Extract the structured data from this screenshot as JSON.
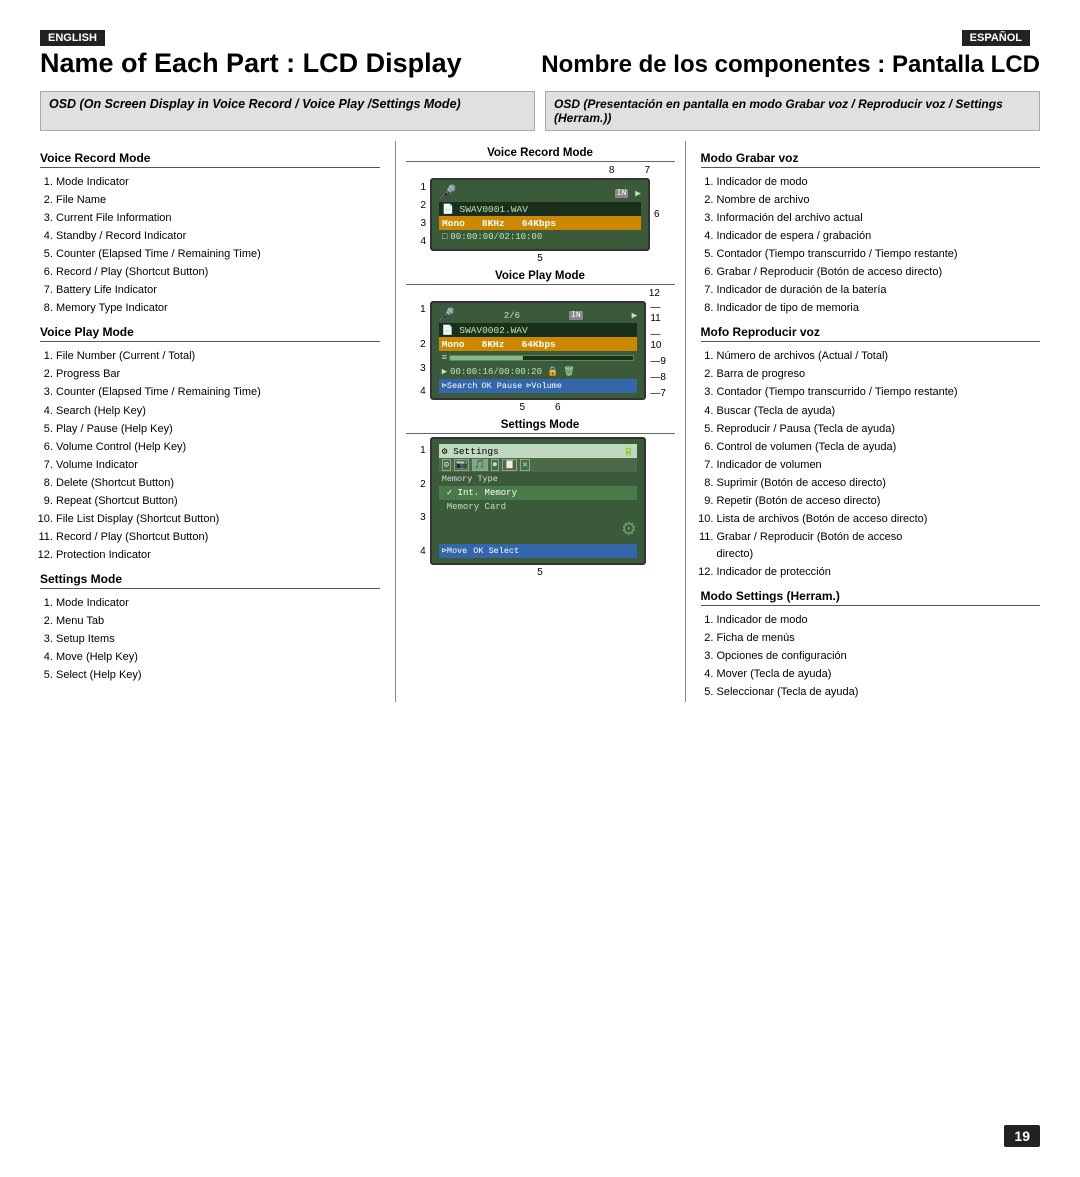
{
  "page": {
    "number": "19",
    "lang_left": "ENGLISH",
    "lang_right": "ESPAÑOL",
    "title_left": "Name of Each Part : LCD Display",
    "title_right": "Nombre de los componentes : Pantalla LCD",
    "subtitle_left": "OSD (On Screen Display in Voice Record / Voice Play /Settings Mode)",
    "subtitle_right": "OSD (Presentación en pantalla en modo Grabar voz / Reproducir voz / Settings (Herram.))"
  },
  "sections": {
    "voice_record_mode": {
      "heading": "Voice Record Mode",
      "items": [
        "Mode Indicator",
        "File Name",
        "Current File Information",
        "Standby / Record Indicator",
        "Counter (Elapsed Time / Remaining Time)",
        "Record / Play (Shortcut Button)",
        "Battery Life Indicator",
        "Memory Type Indicator"
      ]
    },
    "voice_play_mode": {
      "heading": "Voice Play Mode",
      "items": [
        "File Number (Current / Total)",
        "Progress Bar",
        "Counter (Elapsed Time / Remaining Time)",
        "Search (Help Key)",
        "Play / Pause (Help Key)",
        "Volume Control (Help Key)",
        "Volume Indicator",
        "Delete (Shortcut Button)",
        "Repeat (Shortcut Button)",
        "File List Display (Shortcut Button)",
        "Record / Play (Shortcut Button)",
        "Protection Indicator"
      ]
    },
    "settings_mode": {
      "heading": "Settings Mode",
      "items": [
        "Mode Indicator",
        "Menu Tab",
        "Setup Items",
        "Move (Help Key)",
        "Select (Help Key)"
      ]
    },
    "modo_grabar": {
      "heading": "Modo Grabar voz",
      "items": [
        "Indicador de modo",
        "Nombre de archivo",
        "Información del archivo actual",
        "Indicador de espera / grabación",
        "Contador (Tiempo transcurrido / Tiempo restante)",
        "Grabar / Reproducir (Botón de acceso directo)",
        "Indicador de duración de la batería",
        "Indicador de tipo de memoria"
      ]
    },
    "mofo_reproducir": {
      "heading": "Mofo Reproducir voz",
      "items": [
        "Número de archivos (Actual / Total)",
        "Barra de progreso",
        "Contador (Tiempo transcurrido / Tiempo restante)",
        "Buscar (Tecla de ayuda)",
        "Reproducir / Pausa (Tecla de ayuda)",
        "Control de volumen (Tecla de ayuda)",
        "Indicador de volumen",
        "Suprimir (Botón de acceso directo)",
        "Repetir (Botón de acceso directo)",
        "Lista de archivos (Botón de acceso directo)",
        "Grabar / Reproducir (Botón de acceso directo)",
        "Indicador de protección"
      ]
    },
    "modo_settings": {
      "heading": "Modo Settings (Herram.)",
      "items": [
        "Indicador de modo",
        "Ficha de menús",
        "Opciones de configuración",
        "Mover (Tecla de ayuda)",
        "Seleccionar (Tecla de ayuda)"
      ]
    }
  },
  "screens": {
    "voice_record": {
      "label": "Voice Record Mode",
      "row1_left": "🎤",
      "row1_mid": "IN",
      "row1_right": "▶",
      "row2": "SWAV0001.WAV",
      "row3": "Mono  8KHz  64Kbps",
      "row4": "□ 00:00:00/02:10:00",
      "num_8": "8",
      "num_7": "7",
      "num_1": "1",
      "num_6": "6",
      "num_2": "2",
      "num_3": "3",
      "num_4": "4",
      "num_5": "5"
    },
    "voice_play": {
      "label": "Voice Play Mode",
      "row1_left": "🎤",
      "row1_fraction": "2/6",
      "row1_in": "IN",
      "row1_right": "▶",
      "row2": "SWAV0002.WAV",
      "row3": "Mono  8KHz  64Kbps",
      "row4": "▶00:00:16/00:00:20  🔒",
      "row5": "Search  OK Pause  Volume",
      "num_12": "12",
      "num_11": "11",
      "num_1": "1",
      "num_10": "10",
      "num_9": "9",
      "num_2": "2",
      "num_3": "3",
      "num_4": "4",
      "num_8": "8",
      "num_7": "7",
      "num_5": "5",
      "num_6": "6"
    },
    "settings": {
      "label": "Settings Mode",
      "row1": "⚙ Settings",
      "row2_icons": "⚙ 📷 🎵 ⏺ 📋 ⚙",
      "row3_label": "Memory Type",
      "row3_item1": "✓ Int. Memory",
      "row3_item2": "Memory Card",
      "row4": "Move  OK Select",
      "num_1": "1",
      "num_2": "2",
      "num_3": "3",
      "num_4": "4",
      "num_5": "5"
    }
  }
}
